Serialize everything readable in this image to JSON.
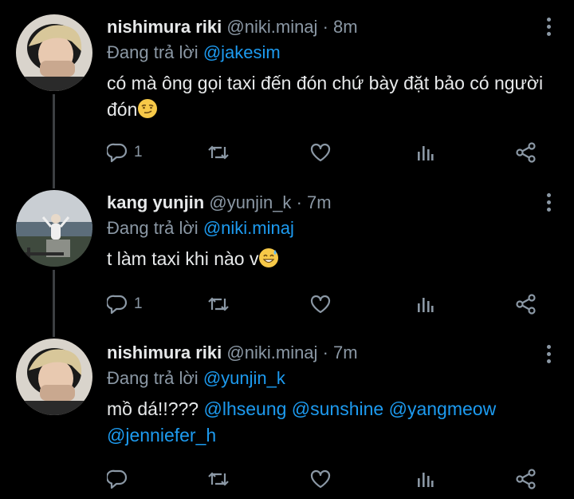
{
  "tweets": [
    {
      "name": "nishimura riki",
      "handle": "@niki.minaj",
      "time": "8m",
      "reply_prefix": "Đang trả lời",
      "reply_to": "@jakesim",
      "text": "có mà ông gọi taxi đến đón chứ bày đặt bảo có người đón",
      "emoji": "smirk-emoji",
      "reply_count": "1"
    },
    {
      "name": "kang yunjin",
      "handle": "@yunjin_k",
      "time": "7m",
      "reply_prefix": "Đang trả lời",
      "reply_to": "@niki.minaj",
      "text": "t làm taxi khi nào v",
      "emoji": "sweat-smile-emoji",
      "reply_count": "1"
    },
    {
      "name": "nishimura riki",
      "handle": "@niki.minaj",
      "time": "7m",
      "reply_prefix": "Đang trả lời",
      "reply_to": "@yunjin_k",
      "text": "mồ dá!!???",
      "mentions": [
        "@lhseung",
        "@sunshine",
        "@yangmeow",
        "@jenniefer_h"
      ],
      "reply_count": ""
    }
  ],
  "separator": "·",
  "colors": {
    "background": "#000000",
    "text": "#e7e9ea",
    "muted": "#8b98a5",
    "accent": "#1d9bf0"
  },
  "icons": [
    "reply-icon",
    "retweet-icon",
    "like-icon",
    "analytics-icon",
    "share-icon",
    "more-icon"
  ]
}
